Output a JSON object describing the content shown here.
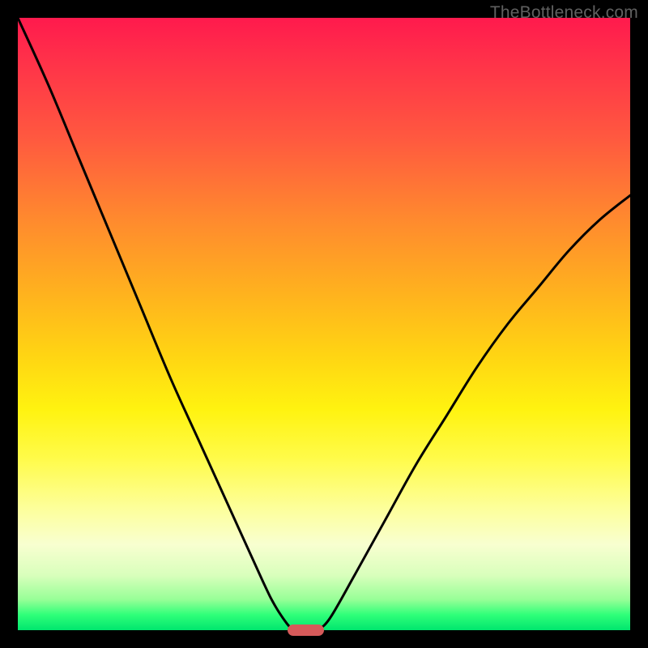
{
  "watermark": "TheBottleneck.com",
  "colors": {
    "frame": "#000000",
    "curve": "#000000",
    "marker": "#d65a5a",
    "gradient_top": "#ff1a4d",
    "gradient_bottom": "#00e66e"
  },
  "chart_data": {
    "type": "line",
    "title": "",
    "xlabel": "",
    "ylabel": "",
    "xlim": [
      0,
      100
    ],
    "ylim": [
      0,
      100
    ],
    "x_units": "percent of plot width",
    "y_units": "percent bottleneck (0 = balanced, 100 = max bottleneck)",
    "series": [
      {
        "name": "left-curve",
        "x": [
          0,
          5,
          10,
          15,
          20,
          25,
          30,
          35,
          40,
          42,
          44,
          45
        ],
        "y": [
          100,
          89,
          77,
          65,
          53,
          41,
          30,
          19,
          8,
          4,
          1,
          0
        ]
      },
      {
        "name": "right-curve",
        "x": [
          49,
          51,
          55,
          60,
          65,
          70,
          75,
          80,
          85,
          90,
          95,
          100
        ],
        "y": [
          0,
          2,
          9,
          18,
          27,
          35,
          43,
          50,
          56,
          62,
          67,
          71
        ]
      }
    ],
    "optimal_marker": {
      "x_start": 44,
      "x_end": 50,
      "y": 0,
      "meaning": "balanced / no-bottleneck region"
    }
  }
}
